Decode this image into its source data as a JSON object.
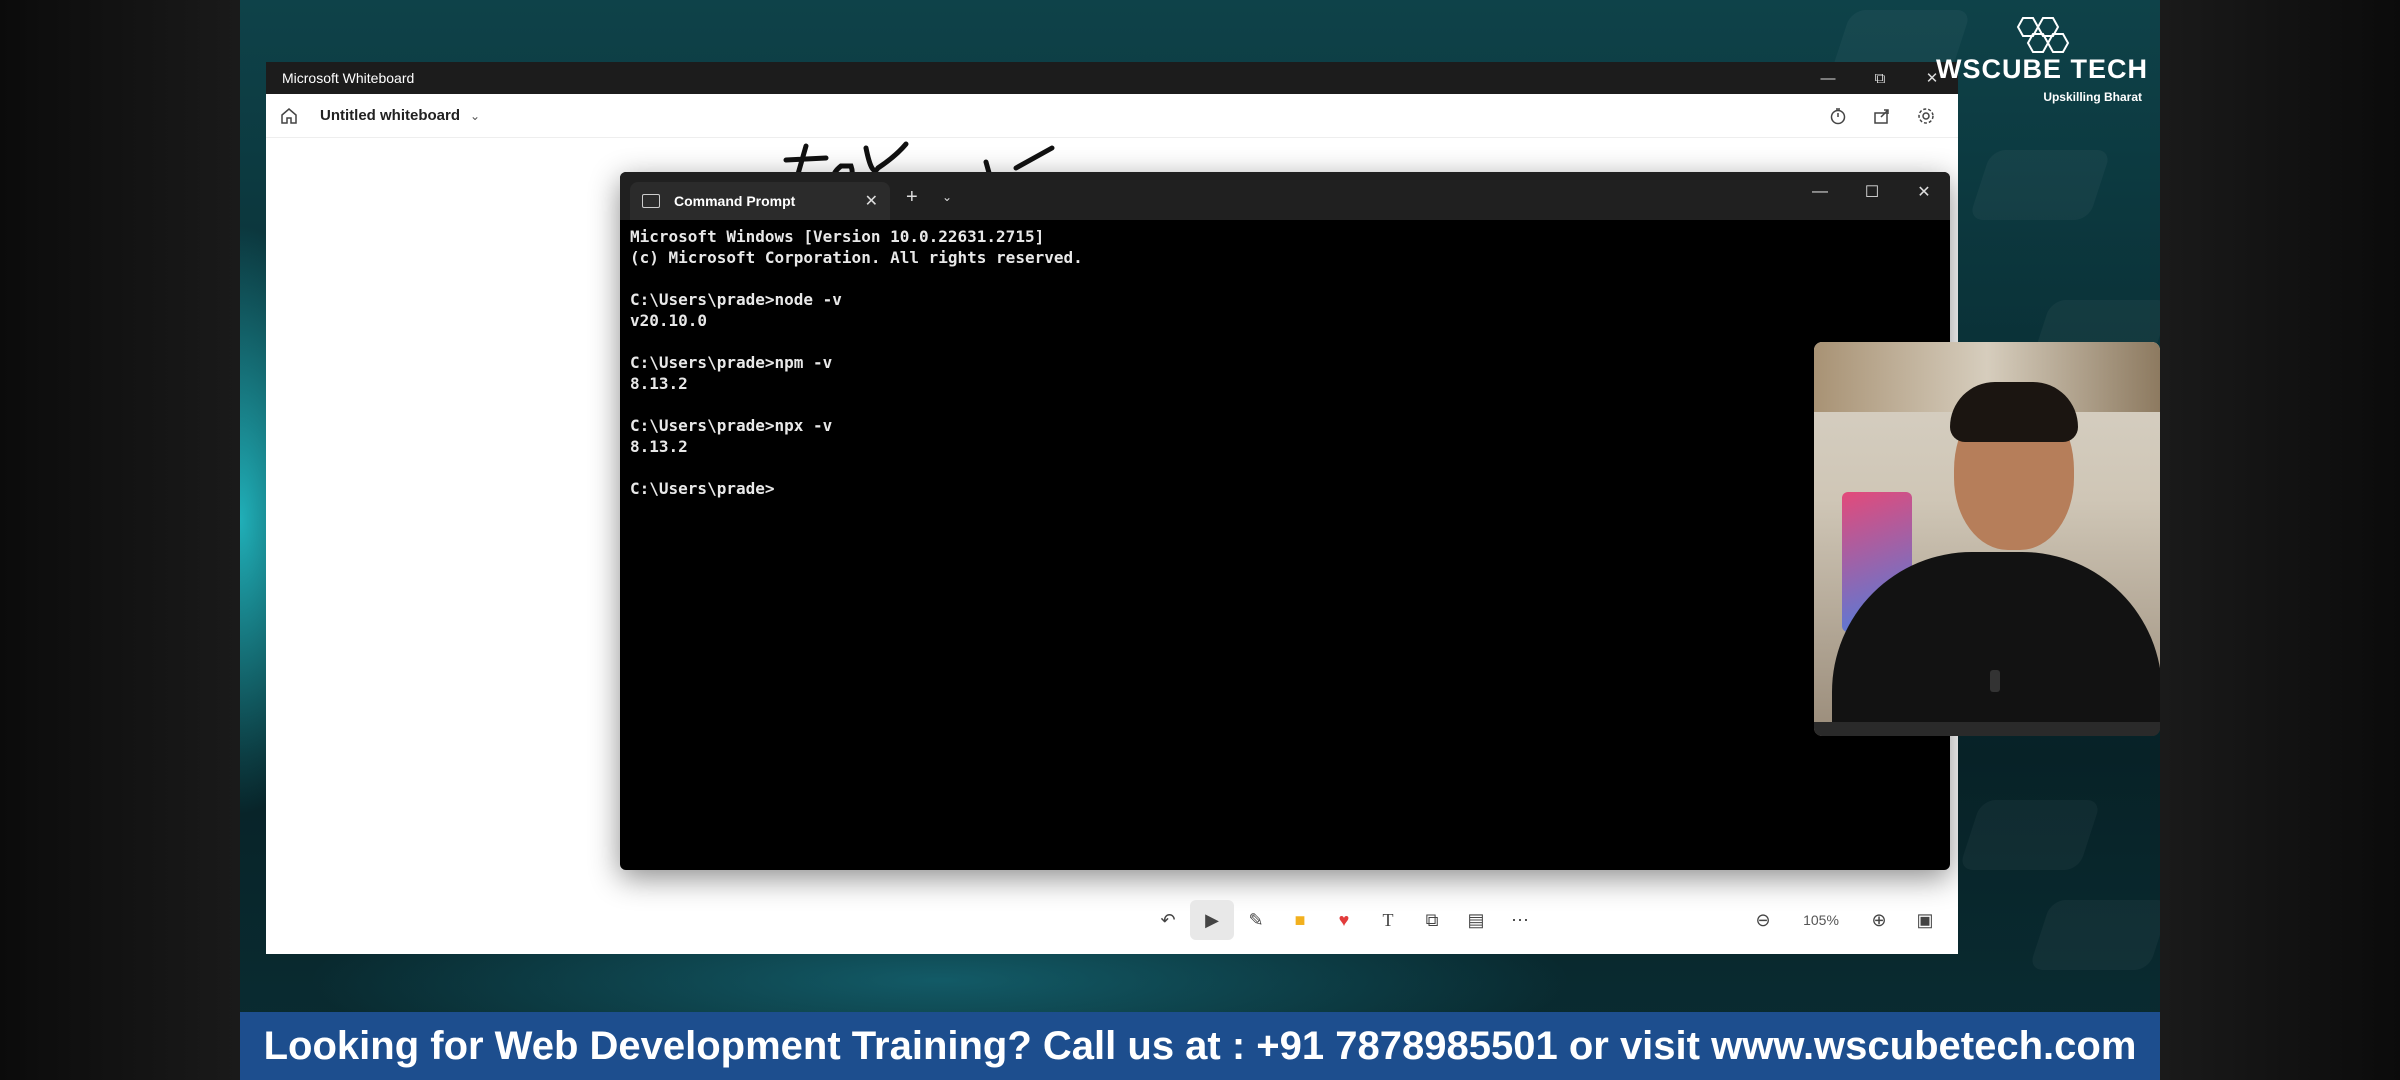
{
  "whiteboard": {
    "app_title": "Microsoft Whiteboard",
    "document_name": "Untitled whiteboard",
    "zoom": "105%"
  },
  "cmd": {
    "tab_title": "Command Prompt",
    "lines": [
      "Microsoft Windows [Version 10.0.22631.2715]",
      "(c) Microsoft Corporation. All rights reserved.",
      "",
      "C:\\Users\\prade>node -v",
      "v20.10.0",
      "",
      "C:\\Users\\prade>npm -v",
      "8.13.2",
      "",
      "C:\\Users\\prade>npx -v",
      "8.13.2",
      "",
      "C:\\Users\\prade>"
    ]
  },
  "logo": {
    "brand": "WsCube Tech",
    "tagline": "Upskilling Bharat"
  },
  "banner": {
    "text": "Looking for Web Development Training? Call us at : +91 7878985501 or visit www.wscubetech.com"
  },
  "icons": {
    "home": "home-icon",
    "timer": "timer-icon",
    "share": "share-icon",
    "settings": "settings-icon"
  }
}
